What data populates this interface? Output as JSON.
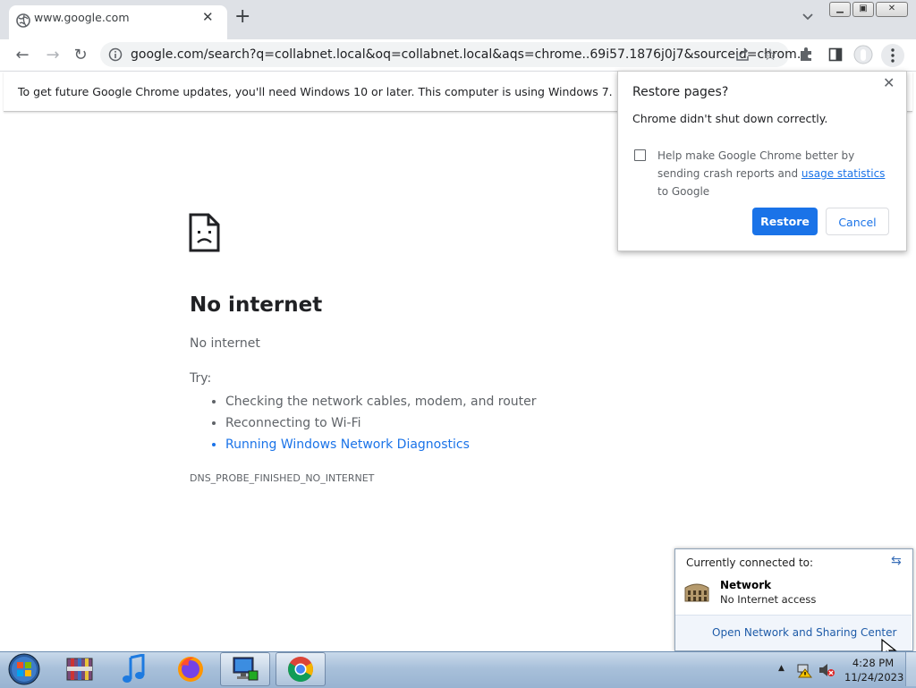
{
  "browser": {
    "tab_title": "www.google.com",
    "url": "google.com/search?q=collabnet.local&oq=collabnet.local&aqs=chrome..69i57.1876j0j7&sourceid=chrom…"
  },
  "infobar": {
    "text": "To get future Google Chrome updates, you'll need Windows 10 or later. This computer is using Windows 7."
  },
  "error_page": {
    "title": "No internet",
    "subtitle": "No internet",
    "try_label": "Try:",
    "suggestions": [
      "Checking the network cables, modem, and router",
      "Reconnecting to Wi-Fi",
      "Running Windows Network Diagnostics"
    ],
    "error_code": "DNS_PROBE_FINISHED_NO_INTERNET"
  },
  "restore_popup": {
    "title": "Restore pages?",
    "description": "Chrome didn't shut down correctly.",
    "help_text_before": "Help make Google Chrome better by sending crash reports and ",
    "help_link": "usage statistics",
    "help_text_after": " to Google",
    "restore_label": "Restore",
    "cancel_label": "Cancel"
  },
  "network_flyout": {
    "header": "Currently connected to:",
    "network_name": "Network",
    "network_status": "No Internet access",
    "link": "Open Network and Sharing Center"
  },
  "taskbar": {
    "time": "4:28 PM",
    "date": "11/24/2023"
  },
  "colors": {
    "accent": "#1a73e8",
    "tabstrip": "#dee1e6",
    "taskbar": "#a8c0da"
  }
}
